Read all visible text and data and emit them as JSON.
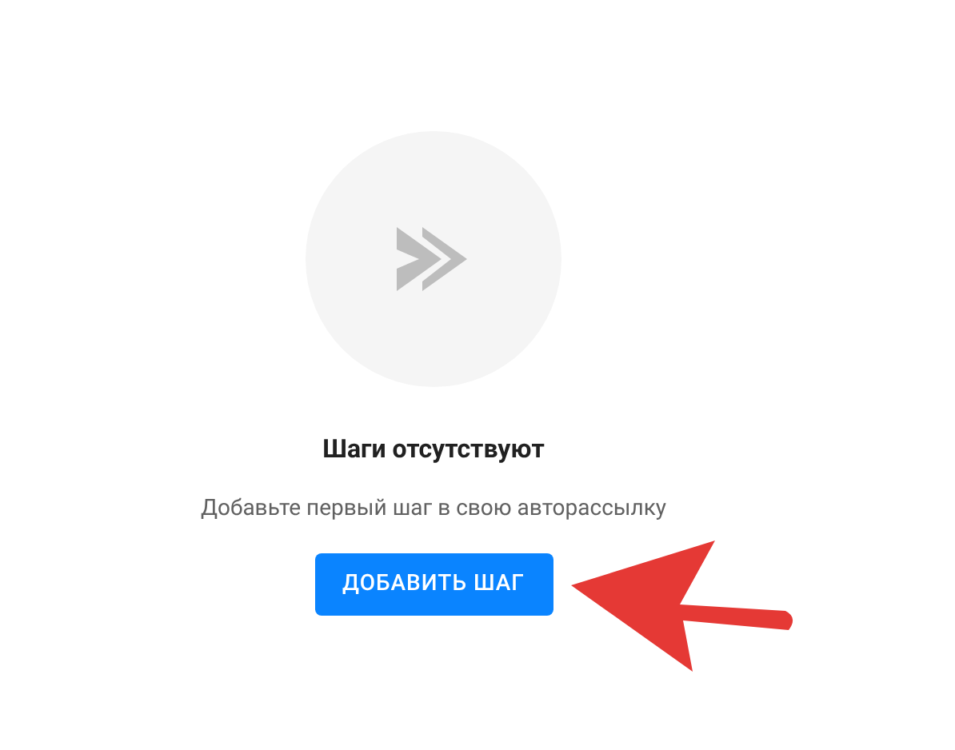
{
  "empty_state": {
    "title": "Шаги отсутствуют",
    "description": "Добавьте первый шаг в свою авторассылку",
    "button": "ДОБАВИТЬ ШАГ"
  }
}
